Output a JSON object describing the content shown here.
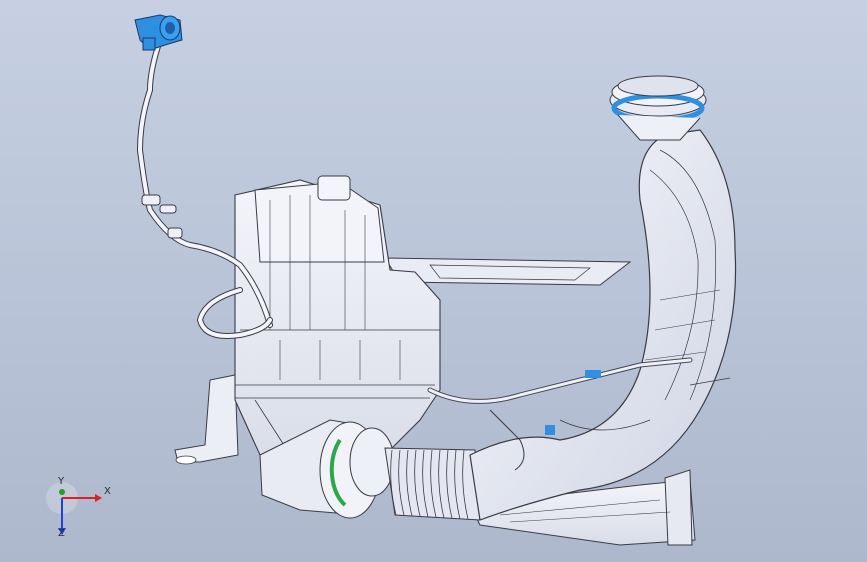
{
  "viewport": {
    "background_top": "#c6d0e2",
    "background_bottom": "#aeb8cd"
  },
  "model": {
    "part_fill": "#eef0f7",
    "edge_color": "#3a3a44",
    "highlight_blue": "#2f8fe0",
    "highlight_green": "#2aa84a",
    "hose_shade": "#d8dcea"
  },
  "triad": {
    "x_label": "X",
    "y_label": "Y",
    "z_label": "Z",
    "x_color": "#e02020",
    "y_color": "#20a020",
    "z_color": "#2040e0"
  }
}
